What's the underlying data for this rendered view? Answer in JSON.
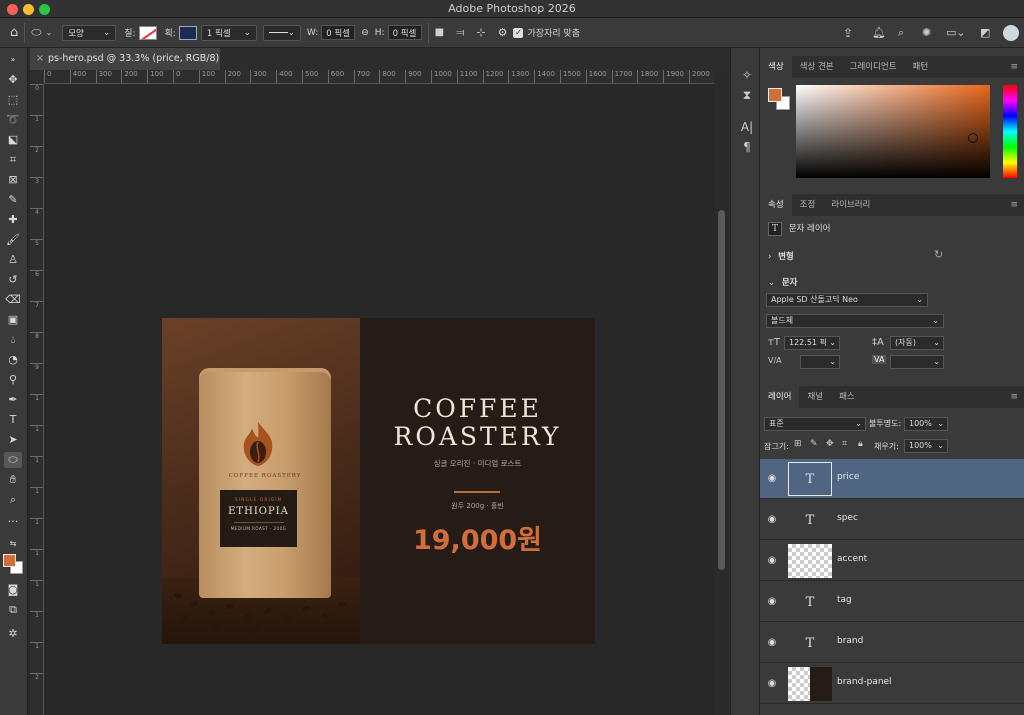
{
  "app": {
    "title": "Adobe Photoshop 2026"
  },
  "options": {
    "shape_mode": "모양",
    "fill_label": "칠:",
    "stroke_label": "획:",
    "stroke_width": "1 픽셀",
    "w_label": "W:",
    "w_value": "0 픽셀",
    "h_label": "H:",
    "h_value": "0 픽셀",
    "align_edges_label": "가장자리 맞춤"
  },
  "document": {
    "tab_title": "ps-hero.psd @ 33.3% (price, RGB/8)",
    "ruler_h": [
      "0",
      "400",
      "300",
      "200",
      "100",
      "0",
      "100",
      "200",
      "300",
      "400",
      "500",
      "600",
      "700",
      "800",
      "900",
      "1000",
      "1100",
      "1200",
      "1300",
      "1400",
      "1500",
      "1600",
      "1700",
      "1800",
      "1900",
      "2000",
      "2100"
    ],
    "ruler_v": [
      "0",
      "1",
      "2",
      "3",
      "4",
      "5",
      "6",
      "7",
      "8",
      "9",
      "1",
      "1",
      "1",
      "1",
      "1",
      "1",
      "1",
      "1",
      "1",
      "2"
    ]
  },
  "artwork": {
    "brand_line1": "COFFEE",
    "brand_line2": "ROASTERY",
    "tagline": "싱글 오리진 · 미디엄 로스트",
    "spec": "원두 200g · 홀빈",
    "price": "19,000원",
    "bag_brand": "COFFEE ROASTERY",
    "bag_origin": "SINGLE ORIGIN",
    "bag_name": "ETHIOPIA",
    "bag_roast": "MEDIUM ROAST · 200G",
    "accent_color": "#d26e3a"
  },
  "panels": {
    "color_tabs": [
      "색상",
      "색상 견본",
      "그레이디언트",
      "패턴"
    ],
    "props_tabs": [
      "속성",
      "조정",
      "라이브러리"
    ],
    "layer_type": "문자 레이어",
    "transform_label": "변형",
    "text_label": "문자",
    "font_family": "Apple SD 산돌고딕 Neo",
    "font_style": "볼드체",
    "font_size": "122.51 픽",
    "leading": "(자동)",
    "tracking_label": "V/A",
    "kerning_label": "VA",
    "layers_tabs": [
      "레이어",
      "채널",
      "패스"
    ],
    "blend_mode": "표준",
    "opacity_label": "불투명도:",
    "opacity_value": "100%",
    "lock_label": "잠그기:",
    "fill_label": "채우기:",
    "fill_value": "100%",
    "foreground_color": "#d26e3a"
  },
  "layers": [
    {
      "name": "price",
      "kind": "text",
      "selected": true
    },
    {
      "name": "spec",
      "kind": "text",
      "selected": false
    },
    {
      "name": "accent",
      "kind": "pixel",
      "selected": false
    },
    {
      "name": "tag",
      "kind": "text",
      "selected": false
    },
    {
      "name": "brand",
      "kind": "text",
      "selected": false
    },
    {
      "name": "brand-panel",
      "kind": "pixel",
      "selected": false
    }
  ]
}
